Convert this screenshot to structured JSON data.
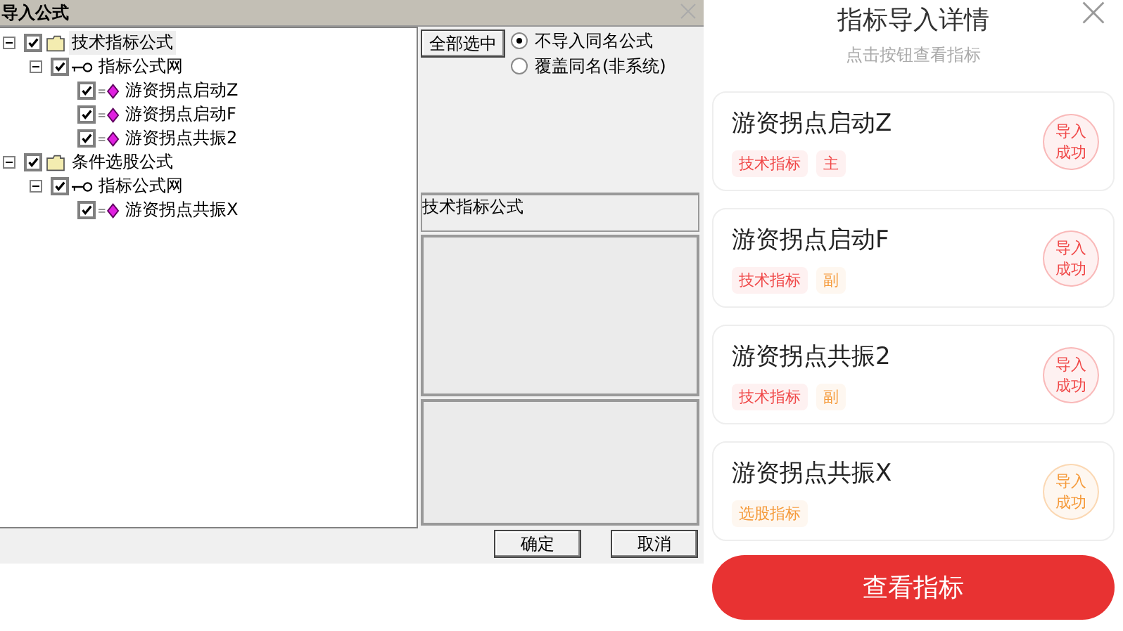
{
  "dialog": {
    "title": "导入公式",
    "tree": [
      {
        "kind": "folder",
        "label": "技术指标公式",
        "checked": true,
        "expanded": true,
        "selected": true,
        "children": [
          {
            "kind": "net",
            "label": "指标公式网",
            "checked": true,
            "expanded": true,
            "selected": false,
            "children": [
              {
                "kind": "formula",
                "label": "游资拐点启动Z",
                "checked": true,
                "selected": false
              },
              {
                "kind": "formula",
                "label": "游资拐点启动F",
                "checked": true,
                "selected": false
              },
              {
                "kind": "formula",
                "label": "游资拐点共振2",
                "checked": true,
                "selected": false
              }
            ]
          }
        ]
      },
      {
        "kind": "folder",
        "label": "条件选股公式",
        "checked": true,
        "expanded": true,
        "selected": false,
        "children": [
          {
            "kind": "net",
            "label": "指标公式网",
            "checked": true,
            "expanded": true,
            "selected": false,
            "children": [
              {
                "kind": "formula",
                "label": "游资拐点共振X",
                "checked": true,
                "selected": false
              }
            ]
          }
        ]
      }
    ],
    "select_all": "全部选中",
    "options": [
      {
        "label": "不导入同名公式",
        "selected": true
      },
      {
        "label": "覆盖同名(非系统)",
        "selected": false
      }
    ],
    "info": "技术指标公式",
    "buttons": [
      "确定",
      "取消"
    ]
  },
  "panel": {
    "title": "指标导入详情",
    "subtitle": "点击按钮查看指标",
    "cards": [
      {
        "name": "游资拐点启动Z",
        "tags": [
          {
            "label": "技术指标",
            "color": "#f04848"
          },
          {
            "label": "主",
            "color": "#f04848"
          }
        ],
        "badge": "导入成功",
        "color": "#f04848"
      },
      {
        "name": "游资拐点启动F",
        "tags": [
          {
            "label": "技术指标",
            "color": "#f04848"
          },
          {
            "label": "副",
            "color": "#f59a3a"
          }
        ],
        "badge": "导入成功",
        "color": "#f04848"
      },
      {
        "name": "游资拐点共振2",
        "tags": [
          {
            "label": "技术指标",
            "color": "#f04848"
          },
          {
            "label": "副",
            "color": "#f59a3a"
          }
        ],
        "badge": "导入成功",
        "color": "#f04848"
      },
      {
        "name": "游资拐点共振X",
        "tags": [
          {
            "label": "选股指标",
            "color": "#f59a3a"
          }
        ],
        "badge": "导入成功",
        "color": "#f59a3a"
      }
    ],
    "button": "查看指标"
  }
}
